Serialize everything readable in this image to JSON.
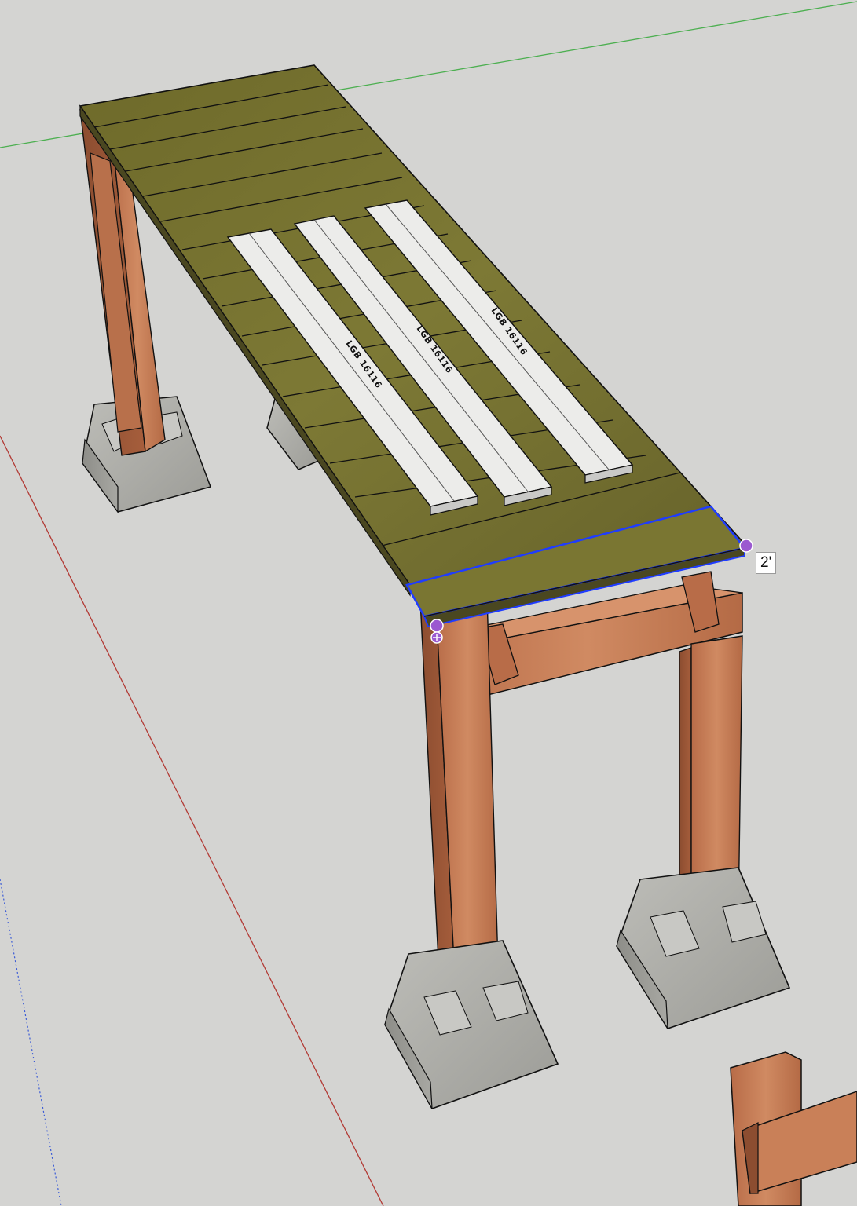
{
  "scene": {
    "description_label": "",
    "dimension_readout": "2'",
    "board_stamps": [
      "LGB 16116",
      "LGB 16116",
      "LGB 16116"
    ],
    "axis_colors": {
      "red": "#c0392b",
      "green": "#4caf50",
      "blue": "#3b5bd6"
    },
    "colors": {
      "background": "#d4d4d2",
      "deck": "#6f6a2c",
      "post": "#c47b55",
      "concrete": "#a9a9a4",
      "white_board": "#efefef",
      "selection": "#1f3cff",
      "inference_point": "#9b59d0"
    }
  },
  "tool": {
    "name": "tape-measure",
    "selected_face": "front-deck-board"
  }
}
